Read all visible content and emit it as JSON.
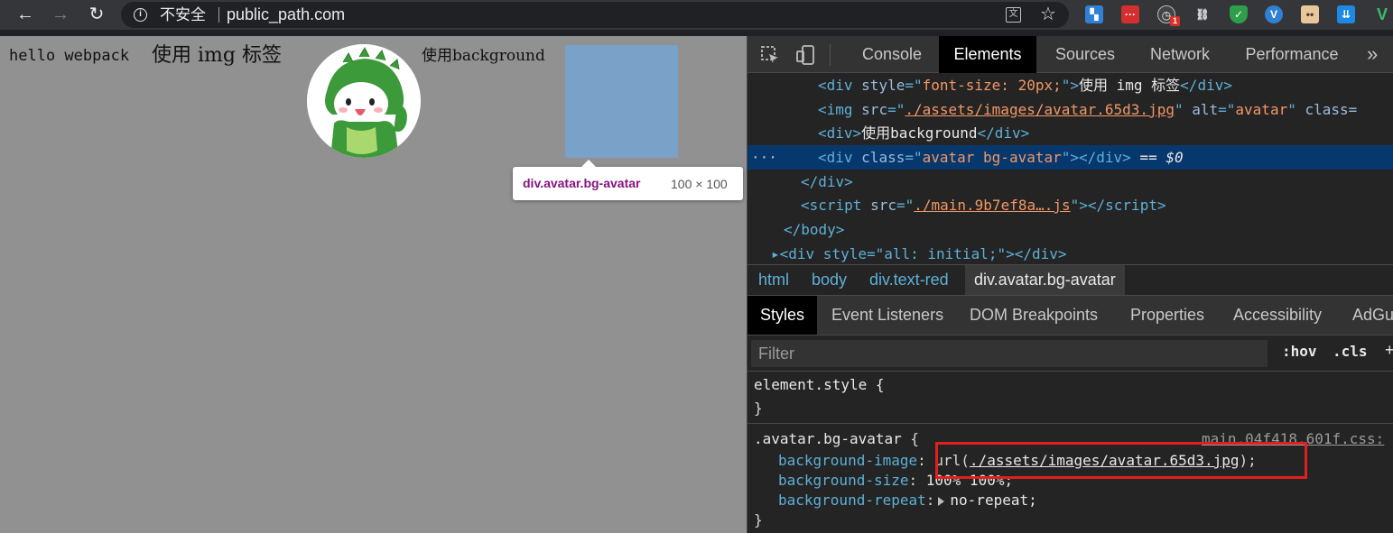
{
  "browser": {
    "insecure_label": "不安全",
    "url": "public_path.com"
  },
  "page": {
    "hello_text": "hello webpack",
    "img_caption": "使用 img 标签",
    "bg_caption": "使用background",
    "tooltip_selector": "div.avatar.bg-avatar",
    "tooltip_size": "100 × 100"
  },
  "devtools": {
    "tabs": [
      "Console",
      "Elements",
      "Sources",
      "Network",
      "Performance"
    ],
    "active_tab": "Elements",
    "dom": {
      "line1_text": "使用 img 标签",
      "line1_style": "font-size: 20px;",
      "line2_src": "./assets/images/avatar.65d3.jpg",
      "line2_alt": "avatar",
      "line3_text": "使用background",
      "line4_class": "avatar bg-avatar",
      "line4_eq": "== $0",
      "line6_src": "./main.9b7ef8a….js",
      "line8_partial": "<div style=\"all: initial;\"></div>"
    },
    "breadcrumbs": [
      "html",
      "body",
      "div.text-red",
      "div.avatar.bg-avatar"
    ],
    "sub_tabs": [
      "Styles",
      "Event Listeners",
      "DOM Breakpoints",
      "Properties",
      "Accessibility",
      "AdGu"
    ],
    "filter_placeholder": "Filter",
    "hov": ":hov",
    "cls": ".cls",
    "element_style": "element.style {",
    "rule": {
      "selector": ".avatar.bg-avatar",
      "source": "main.04f418.601f.css:",
      "bg_image_prop": "background-image",
      "bg_image_url": "./assets/images/avatar.65d3.jpg",
      "bg_size_prop": "background-size",
      "bg_size_val": "100% 100%;",
      "bg_repeat_prop": "background-repeat",
      "bg_repeat_val": "no-repeat;"
    }
  },
  "colors": {
    "page_bg": "#919191",
    "highlight": "#7aa1c7",
    "annotation_red": "#e0201c",
    "devtools_bg": "#242424"
  }
}
